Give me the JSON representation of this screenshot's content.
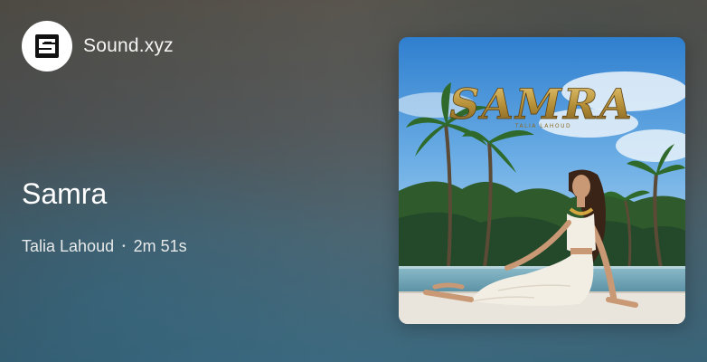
{
  "brand": {
    "name": "Sound.xyz",
    "logo_icon": "sound-logo-icon"
  },
  "track": {
    "title": "Samra",
    "artist": "Talia Lahoud",
    "separator": "•",
    "duration": "2m 51s"
  },
  "cover": {
    "icon": "album-cover-art",
    "title_text": "SAMRA",
    "subtitle_text": "TALIA LAHOUD",
    "colors": {
      "sky": "#3f8fd6",
      "sky_light": "#cfe4f4",
      "palm": "#2f5a2a",
      "pool": "#6fa6b9",
      "deck": "#e9e4dc",
      "dress": "#f3eee4",
      "gold": "#b8923a"
    }
  }
}
